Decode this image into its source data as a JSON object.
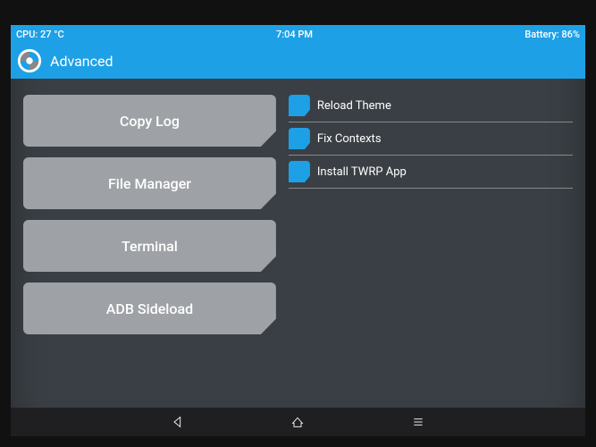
{
  "status": {
    "cpu": "CPU: 27 °C",
    "time": "7:04 PM",
    "battery": "Battery: 86%"
  },
  "title": "Advanced",
  "buttons": {
    "copy_log": "Copy Log",
    "file_manager": "File Manager",
    "terminal": "Terminal",
    "adb_sideload": "ADB Sideload"
  },
  "options": {
    "reload_theme": "Reload Theme",
    "fix_contexts": "Fix Contexts",
    "install_twrp_app": "Install TWRP App"
  }
}
